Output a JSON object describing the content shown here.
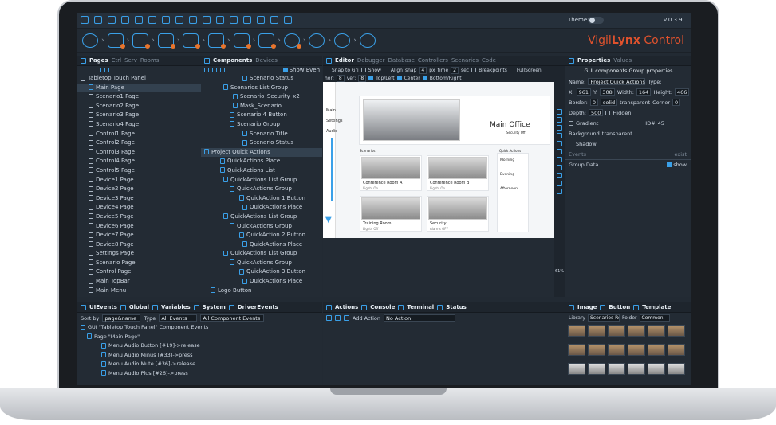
{
  "topbar": {
    "theme_label": "Theme:",
    "version": "v.0.3.9"
  },
  "brand": {
    "name_pre": "Vigil",
    "name_bold": "Lynx",
    "name_post": " Control"
  },
  "left_panel": {
    "tabs": [
      "Pages",
      "Ctrl",
      "Serv",
      "Rooms"
    ],
    "tree": [
      "Tabletop Touch Panel",
      "Main Page",
      "Scenario1 Page",
      "Scenario2 Page",
      "Scenario3 Page",
      "Scenario4 Page",
      "Control1 Page",
      "Control2 Page",
      "Control3 Page",
      "Control4 Page",
      "Control5 Page",
      "Device1 Page",
      "Device2 Page",
      "Device3 Page",
      "Device4 Page",
      "Device5 Page",
      "Device6 Page",
      "Device7 Page",
      "Device8 Page",
      "Settings Page",
      "Scenario Page",
      "Control Page",
      "Main TopBar",
      "Main Menu"
    ]
  },
  "components_panel": {
    "tabs": [
      "Components",
      "Devices"
    ],
    "show_events": "Show Even",
    "tree": [
      "Scenario Status",
      "Scenarios List Group",
      "Scenario_Security_x2",
      "Mask_Scenario",
      "Scenario 4 Button",
      "Scenario Group",
      "Scenario Title",
      "Scenario Status",
      "Project Quick Actions",
      "QuickActions Place",
      "QuickActions List",
      "QuickActions List Group",
      "QuickActions Group",
      "QuickAction 1 Button",
      "QuickActions Place",
      "QuickActions List Group",
      "QuickActions Group",
      "QuickAction 2 Button",
      "QuickActions Place",
      "QuickActions List Group",
      "QuickActions Group",
      "QuickAction 3 Button",
      "QuickActions Place",
      "Logo Button"
    ]
  },
  "editor": {
    "tabs": [
      "Editor",
      "Debugger",
      "Database",
      "Controllers",
      "Scenarios",
      "Code"
    ],
    "row1": [
      "Snap to Gri",
      "Show",
      "Align",
      "snap",
      "4",
      "px",
      "time",
      "2",
      "sec",
      "Breakpoints",
      "FullScreen"
    ],
    "row2": [
      "hor:",
      "8",
      "ver:",
      "8",
      "Top/Left",
      "Center",
      "Bottom/Right"
    ],
    "preview": {
      "menu": [
        "Main",
        "Settings",
        "Audio"
      ],
      "title": "Main Office",
      "subtitle": "Security Off",
      "scenarios_label": "Scenarios",
      "quick_actions_label": "Quick Actions",
      "rooms": [
        {
          "name": "Conference Room A",
          "status": "Lights On"
        },
        {
          "name": "Conference Room B",
          "status": "Lights On"
        },
        {
          "name": "Training Room",
          "status": "Lights Off"
        },
        {
          "name": "Security",
          "status": "Alarms OFF"
        }
      ],
      "quick_actions": [
        "Morning",
        "Evening",
        "Afternoon"
      ]
    }
  },
  "properties": {
    "tabs": [
      "Properties",
      "Values"
    ],
    "title": "GUI components Group properties",
    "name_label": "Name:",
    "name_value": "Project Quick Actions",
    "type_label": "Type:",
    "x_label": "X:",
    "x": "961",
    "y_label": "Y:",
    "y": "308",
    "w_label": "Width:",
    "w": "164",
    "h_label": "Height:",
    "h": "466",
    "border_label": "Border:",
    "border": "0",
    "border_style": "solid",
    "transparent": "transparent",
    "corner_label": "Corner",
    "corner": "0",
    "depth_label": "Depth:",
    "depth": "500",
    "hidden": "Hidden",
    "gradient": "Gradient",
    "id_label": "ID#",
    "id": "45",
    "background_label": "Background",
    "background": "transparent",
    "shadow": "Shadow",
    "events_label": "Events",
    "exist": "exist",
    "group_data": "Group Data",
    "show": "show"
  },
  "bottom_left": {
    "tabs": [
      "UIEvents",
      "Global",
      "Variables",
      "System",
      "DriverEvents"
    ],
    "sort_label": "Sort by",
    "sort_value": "page&name",
    "type_label": "Type",
    "type_value": "All Events",
    "filter_value": "All Component Events",
    "tree": [
      "GUI \"Tabletop Touch Panel\" Component Events",
      "Page \"Main Page\"",
      "Menu Audio Button [#19]->release",
      "Menu Audio Minus [#33]->press",
      "Menu Audio Mute [#36]->release",
      "Menu Audio Plus [#26]->press"
    ]
  },
  "bottom_mid": {
    "tabs": [
      "Actions",
      "Console",
      "Terminal",
      "Status"
    ],
    "add_action": "Add Action",
    "no_action": "No Action"
  },
  "bottom_right": {
    "tabs": [
      "Image",
      "Button",
      "Template"
    ],
    "library": "Library",
    "lib_value": "Scenarios Ro",
    "folder_label": "Folder",
    "folder_value": "Common"
  },
  "zoom": "61%"
}
